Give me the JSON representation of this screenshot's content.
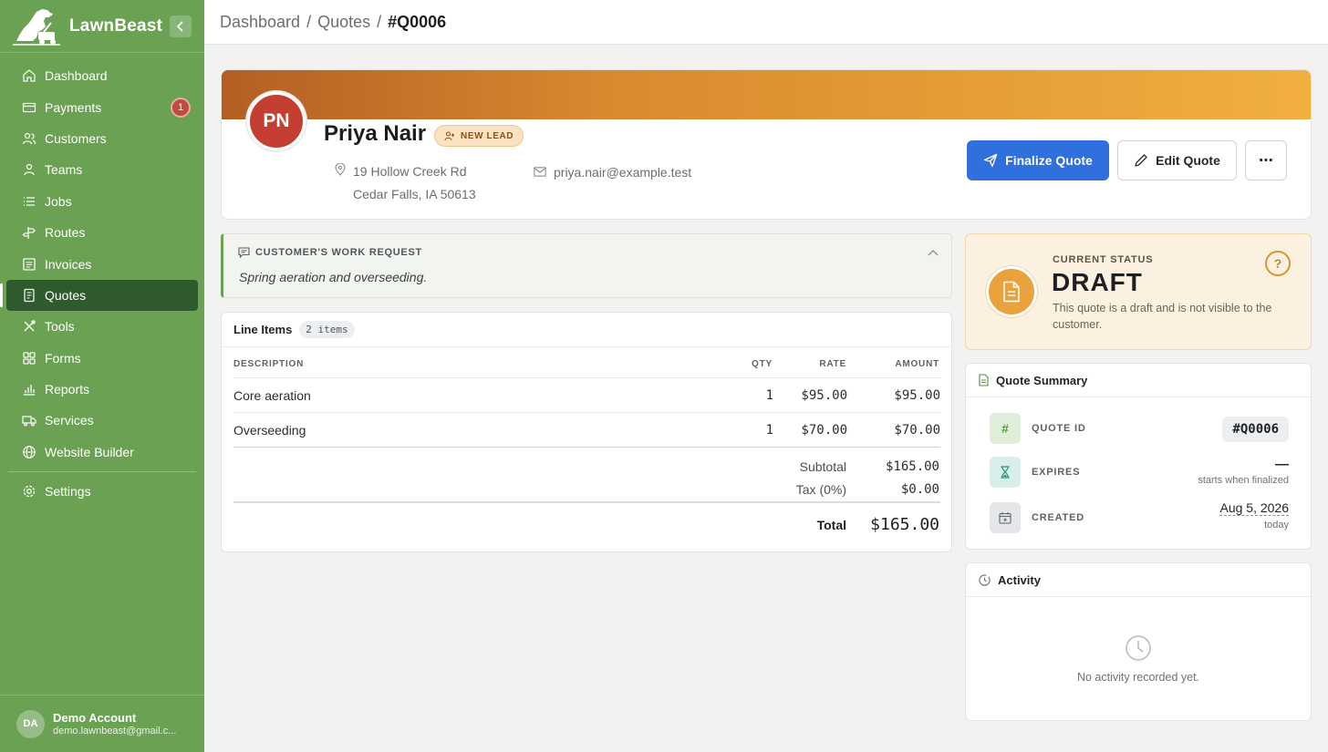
{
  "app": {
    "name": "LawnBeast"
  },
  "sidebar": {
    "items": [
      {
        "label": "Dashboard",
        "icon": "home-icon"
      },
      {
        "label": "Payments",
        "icon": "credit-card-icon",
        "badge": "1"
      },
      {
        "label": "Customers",
        "icon": "users-icon"
      },
      {
        "label": "Teams",
        "icon": "team-icon"
      },
      {
        "label": "Jobs",
        "icon": "list-icon"
      },
      {
        "label": "Routes",
        "icon": "signpost-icon"
      },
      {
        "label": "Invoices",
        "icon": "invoice-icon"
      },
      {
        "label": "Quotes",
        "icon": "quote-icon",
        "active": true
      },
      {
        "label": "Tools",
        "icon": "tools-icon"
      },
      {
        "label": "Forms",
        "icon": "grid-icon"
      },
      {
        "label": "Reports",
        "icon": "bar-chart-icon"
      },
      {
        "label": "Services",
        "icon": "truck-icon"
      },
      {
        "label": "Website Builder",
        "icon": "globe-icon"
      }
    ],
    "settings_label": "Settings",
    "account": {
      "initials": "DA",
      "name": "Demo Account",
      "email": "demo.lawnbeast@gmail.c..."
    }
  },
  "breadcrumb": {
    "items": [
      "Dashboard",
      "Quotes"
    ],
    "current": "#Q0006",
    "separator": "/"
  },
  "customer": {
    "initials": "PN",
    "name": "Priya Nair",
    "badge": "NEW LEAD",
    "address_line1": "19 Hollow Creek Rd",
    "address_line2": "Cedar Falls, IA 50613",
    "email": "priya.nair@example.test"
  },
  "actions": {
    "finalize": "Finalize Quote",
    "edit": "Edit Quote",
    "more": "⋯"
  },
  "work_request": {
    "title": "CUSTOMER'S WORK REQUEST",
    "body": "Spring aeration and overseeding."
  },
  "line_items": {
    "title": "Line Items",
    "count": "2 items",
    "headers": {
      "description": "DESCRIPTION",
      "qty": "QTY",
      "rate": "RATE",
      "amount": "AMOUNT"
    },
    "rows": [
      {
        "description": "Core aeration",
        "qty": "1",
        "rate": "$95.00",
        "amount": "$95.00"
      },
      {
        "description": "Overseeding",
        "qty": "1",
        "rate": "$70.00",
        "amount": "$70.00"
      }
    ],
    "subtotal_label": "Subtotal",
    "subtotal": "$165.00",
    "tax_label": "Tax (0%)",
    "tax": "$0.00",
    "total_label": "Total",
    "total": "$165.00"
  },
  "status": {
    "label": "CURRENT STATUS",
    "value": "DRAFT",
    "description": "This quote is a draft and is not visible to the customer.",
    "help": "?"
  },
  "summary": {
    "title": "Quote Summary",
    "quote_id_label": "QUOTE ID",
    "quote_id": "#Q0006",
    "expires_label": "EXPIRES",
    "expires": "—",
    "expires_note": "starts when finalized",
    "created_label": "CREATED",
    "created": "Aug 5, 2026",
    "created_note": "today"
  },
  "activity": {
    "title": "Activity",
    "empty": "No activity recorded yet."
  },
  "colors": {
    "sidebar": "#6aa152",
    "sidebar_active": "#2e5a2e",
    "primary": "#2f6fde",
    "avatar": "#c43f32",
    "status": "#eaa23c"
  }
}
